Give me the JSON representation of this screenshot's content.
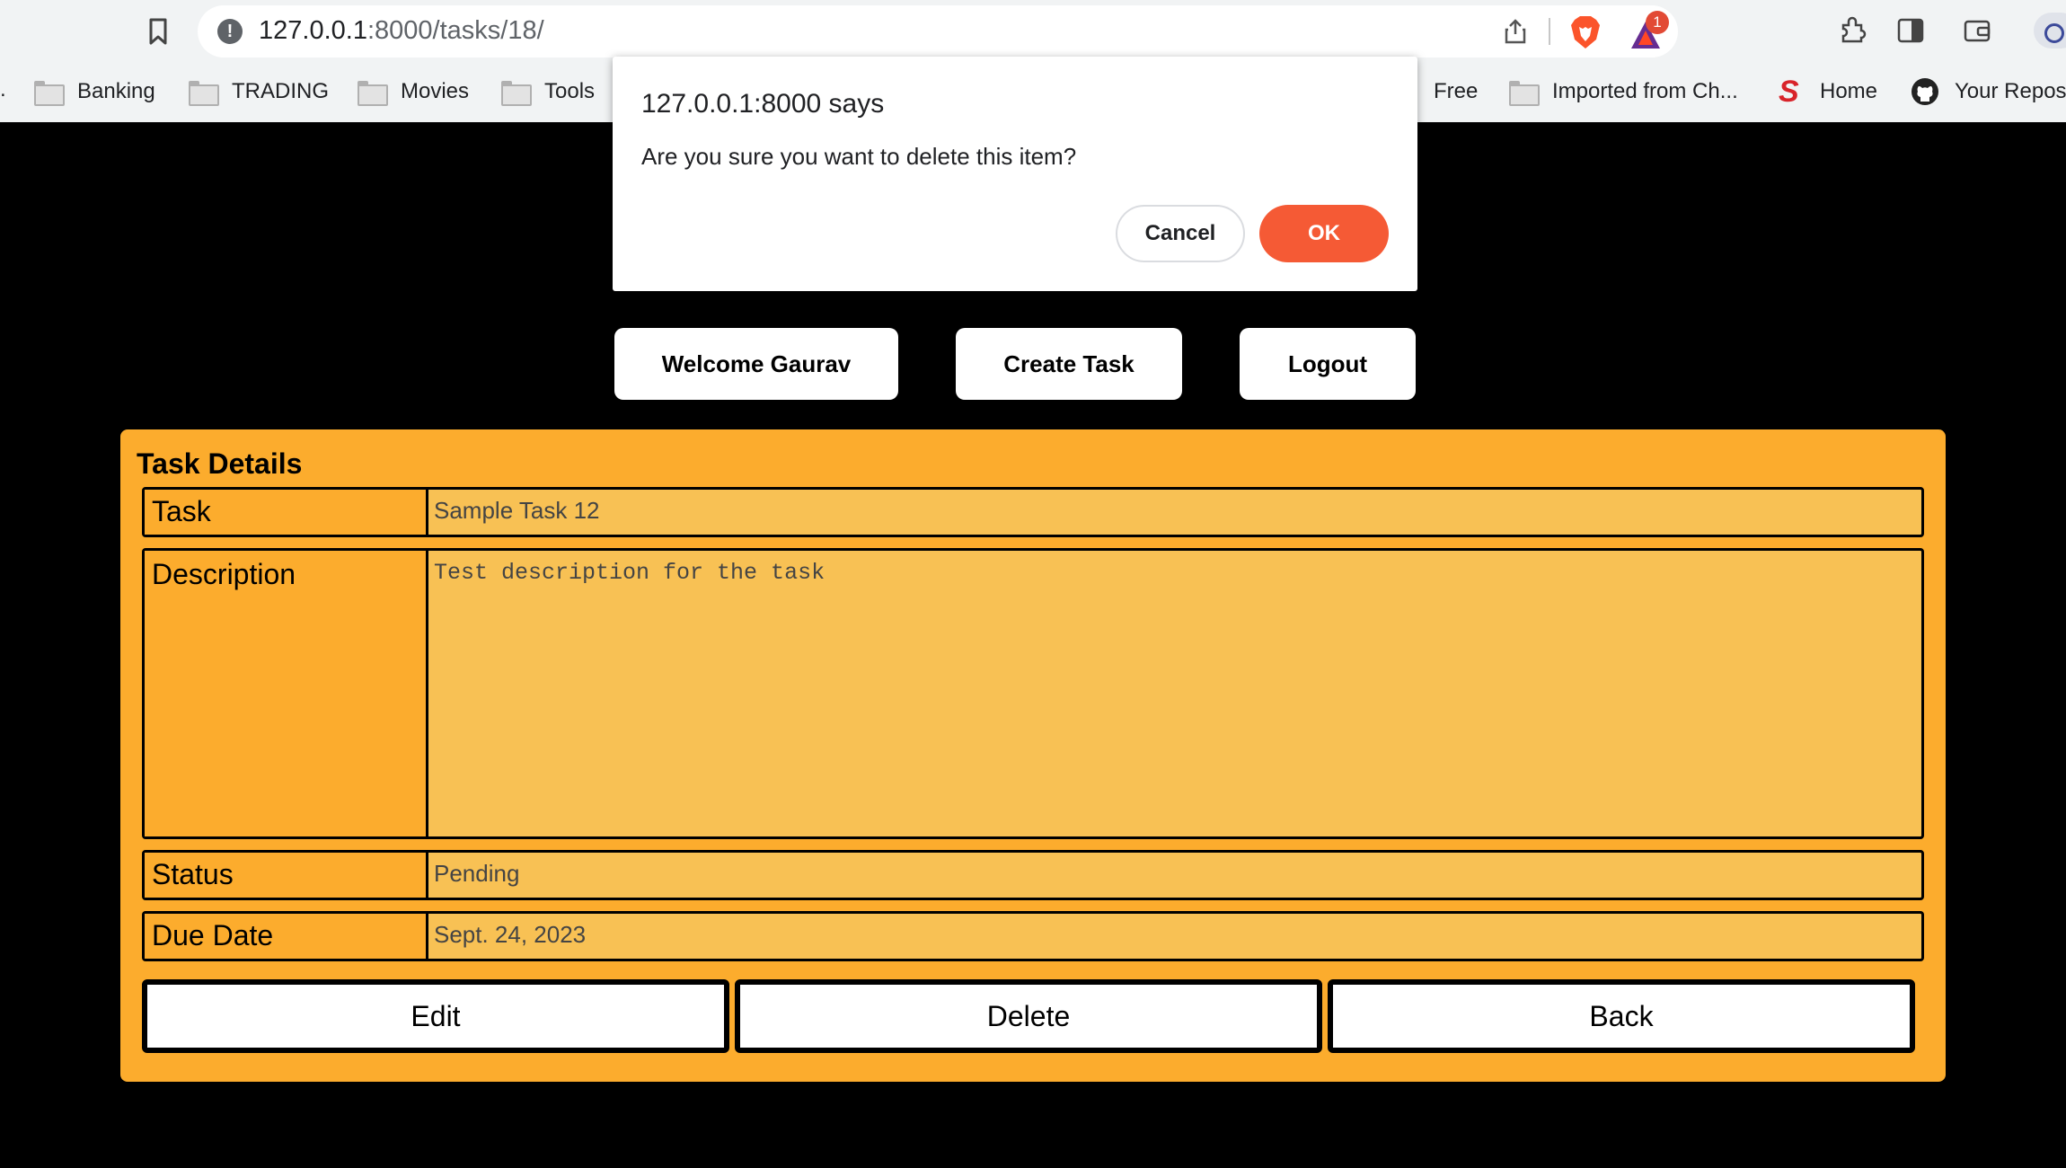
{
  "browser": {
    "url_host": "127.0.0.1",
    "url_path": ":8000/tasks/18/",
    "notification_count": "1",
    "bookmarks": {
      "leading_dot": ".",
      "banking": "Banking",
      "trading": "TRADING",
      "movies": "Movies",
      "tools": "Tools",
      "free": "Free",
      "imported": "Imported from Ch...",
      "home": "Home",
      "repos": "Your Repos"
    }
  },
  "nav": {
    "welcome": "Welcome Gaurav",
    "create_task": "Create Task",
    "logout": "Logout"
  },
  "task_details": {
    "title": "Task Details",
    "task_label": "Task",
    "task_value": "Sample Task 12",
    "description_label": "Description",
    "description_value": "Test description for the task",
    "status_label": "Status",
    "status_value": "Pending",
    "due_label": "Due Date",
    "due_value": "Sept. 24, 2023"
  },
  "actions": {
    "edit": "Edit",
    "delete": "Delete",
    "back": "Back"
  },
  "dialog": {
    "title": "127.0.0.1:8000 says",
    "message": "Are you sure you want to delete this item?",
    "cancel": "Cancel",
    "ok": "OK"
  },
  "colors": {
    "card": "#fcac2d",
    "field_value_bg": "#f8c154",
    "ok_button": "#f55a35",
    "page_bg": "#000000"
  },
  "icons": [
    "bookmark-icon",
    "info-icon",
    "share-icon",
    "brave-lion-icon",
    "brave-rewards-icon",
    "extensions-icon",
    "sidebar-icon",
    "wallet-icon",
    "profile-icon",
    "folder-icon",
    "s-logo-icon",
    "github-icon"
  ]
}
